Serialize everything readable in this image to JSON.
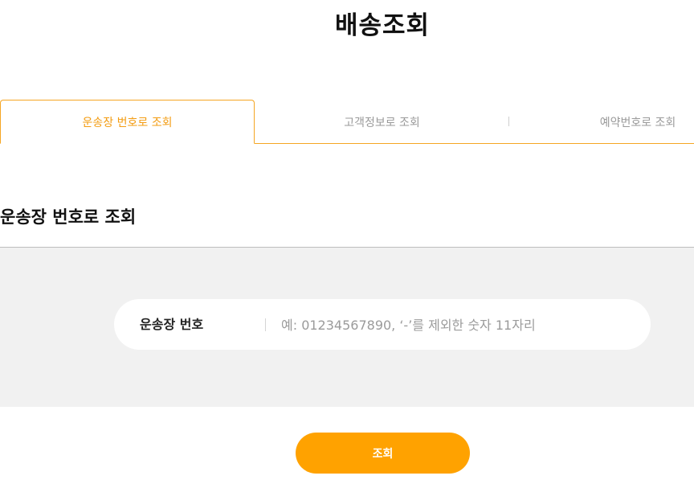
{
  "page": {
    "title": "배송조회"
  },
  "tabs": [
    {
      "label": "운송장 번호로 조회",
      "active": true
    },
    {
      "label": "고객정보로 조회",
      "active": false
    },
    {
      "label": "예약번호로 조회",
      "active": false
    }
  ],
  "section": {
    "title": "운송장 번호로 조회",
    "field_label": "운송장 번호",
    "field_placeholder": "예: 01234567890, ‘-’를 제외한 숫자 11자리",
    "field_value": ""
  },
  "actions": {
    "submit_label": "조회"
  },
  "colors": {
    "accent": "#ffa200",
    "active_tab_text": "#f39c12",
    "tab_border": "#f5a623",
    "search_bg": "#f1f1f1"
  }
}
